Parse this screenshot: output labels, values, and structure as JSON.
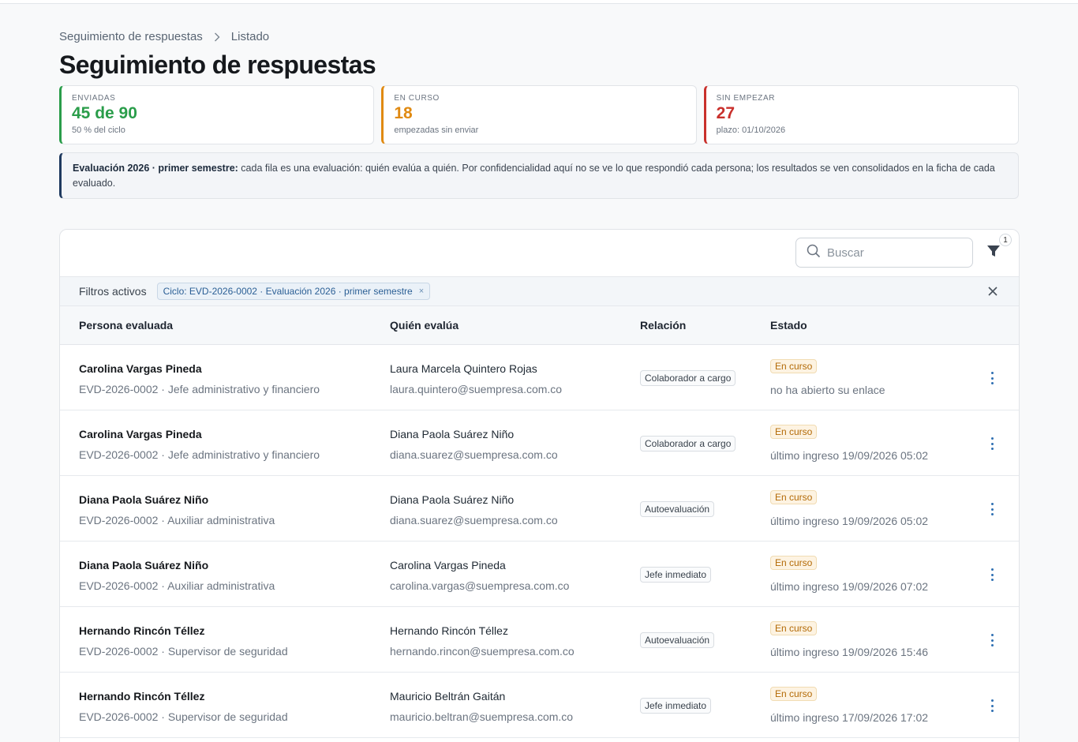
{
  "breadcrumb": {
    "parent": "Seguimiento de respuestas",
    "current": "Listado"
  },
  "page": {
    "title": "Seguimiento de respuestas"
  },
  "stats": [
    {
      "label": "ENVIADAS",
      "value": "45 de 90",
      "sub": "50 % del ciclo",
      "color": "#2a9d4a"
    },
    {
      "label": "EN CURSO",
      "value": "18",
      "sub": "empezadas sin enviar",
      "color": "#e08a12"
    },
    {
      "label": "SIN EMPEZAR",
      "value": "27",
      "sub": "plazo: 01/10/2026",
      "color": "#c9302c"
    }
  ],
  "info": {
    "bold": "Evaluación 2026 · primer semestre:",
    "text": " cada fila es una evaluación: quién evalúa a quién. Por confidencialidad aquí no se ve lo que respondió cada persona; los resultados se ven consolidados en la ficha de cada evaluado."
  },
  "toolbar": {
    "search_placeholder": "Buscar",
    "filter_count": "1"
  },
  "filters": {
    "label": "Filtros activos",
    "chip": "Ciclo: EVD-2026-0002 · Evaluación 2026 · primer semestre",
    "chip_remove": "×"
  },
  "table": {
    "headers": [
      "Persona evaluada",
      "Quién evalúa",
      "Relación",
      "Estado"
    ],
    "rows": [
      {
        "person": "Carolina Vargas Pineda",
        "person_sub": "EVD-2026-0002 · Jefe administrativo y financiero",
        "evaluator": "Laura Marcela Quintero Rojas",
        "email": "laura.quintero@suempresa.com.co",
        "relation": "Colaborador a cargo",
        "state": "En curso",
        "note": "no ha abierto su enlace"
      },
      {
        "person": "Carolina Vargas Pineda",
        "person_sub": "EVD-2026-0002 · Jefe administrativo y financiero",
        "evaluator": "Diana Paola Suárez Niño",
        "email": "diana.suarez@suempresa.com.co",
        "relation": "Colaborador a cargo",
        "state": "En curso",
        "note": "último ingreso 19/09/2026 05:02"
      },
      {
        "person": "Diana Paola Suárez Niño",
        "person_sub": "EVD-2026-0002 · Auxiliar administrativa",
        "evaluator": "Diana Paola Suárez Niño",
        "email": "diana.suarez@suempresa.com.co",
        "relation": "Autoevaluación",
        "state": "En curso",
        "note": "último ingreso 19/09/2026 05:02"
      },
      {
        "person": "Diana Paola Suárez Niño",
        "person_sub": "EVD-2026-0002 · Auxiliar administrativa",
        "evaluator": "Carolina Vargas Pineda",
        "email": "carolina.vargas@suempresa.com.co",
        "relation": "Jefe inmediato",
        "state": "En curso",
        "note": "último ingreso 19/09/2026 07:02"
      },
      {
        "person": "Hernando Rincón Téllez",
        "person_sub": "EVD-2026-0002 · Supervisor de seguridad",
        "evaluator": "Hernando Rincón Téllez",
        "email": "hernando.rincon@suempresa.com.co",
        "relation": "Autoevaluación",
        "state": "En curso",
        "note": "último ingreso 19/09/2026 15:46"
      },
      {
        "person": "Hernando Rincón Téllez",
        "person_sub": "EVD-2026-0002 · Supervisor de seguridad",
        "evaluator": "Mauricio Beltrán Gaitán",
        "email": "mauricio.beltran@suempresa.com.co",
        "relation": "Jefe inmediato",
        "state": "En curso",
        "note": "último ingreso 17/09/2026 17:02"
      }
    ]
  }
}
